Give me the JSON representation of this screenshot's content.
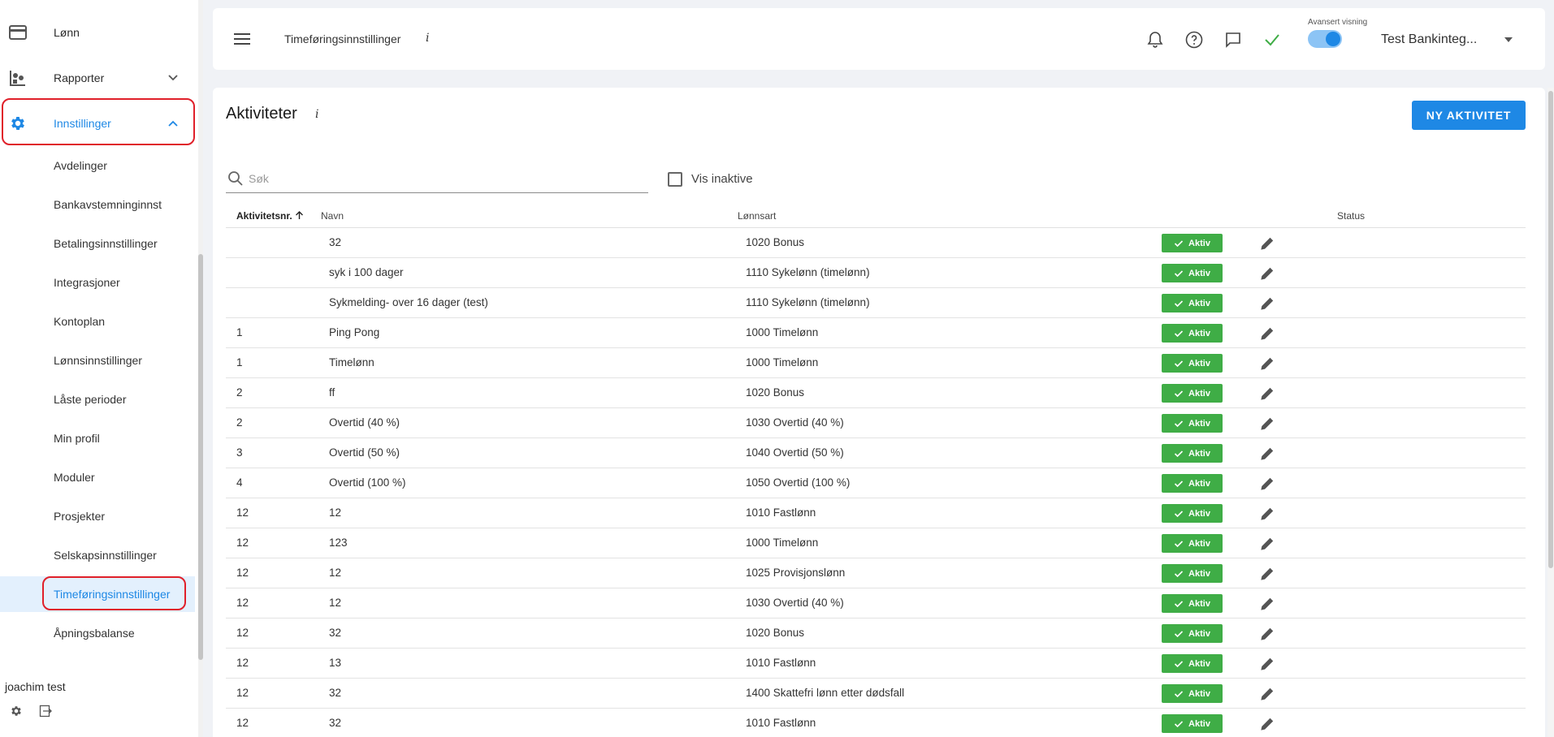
{
  "sidebar": {
    "nav": [
      {
        "label": "Lønn",
        "icon": "credit-card-icon"
      },
      {
        "label": "Rapporter",
        "icon": "reports-icon"
      },
      {
        "label": "Innstillinger",
        "icon": "gear-icon"
      }
    ],
    "sub_items": [
      {
        "label": "Avdelinger"
      },
      {
        "label": "Bankavstemninginnst"
      },
      {
        "label": "Betalingsinnstillinger"
      },
      {
        "label": "Integrasjoner"
      },
      {
        "label": "Kontoplan"
      },
      {
        "label": "Lønnsinnstillinger"
      },
      {
        "label": "Låste perioder"
      },
      {
        "label": "Min profil"
      },
      {
        "label": "Moduler"
      },
      {
        "label": "Prosjekter"
      },
      {
        "label": "Selskapsinnstillinger"
      },
      {
        "label": "Timeføringsinnstillinger"
      },
      {
        "label": "Åpningsbalanse"
      }
    ],
    "user": "joachim test",
    "accent_color": "#1e88e5",
    "highlight_color": "#e0202a"
  },
  "topbar": {
    "title": "Timeføringsinnstillinger",
    "info": "i",
    "advanced_label": "Avansert visning",
    "advanced_on": true,
    "company": "Test Bankinteg...",
    "icons": [
      "bell-icon",
      "help-icon",
      "chat-icon",
      "check-icon"
    ]
  },
  "main": {
    "title": "Aktiviteter",
    "info": "i",
    "new_button": "NY AKTIVITET",
    "search_placeholder": "Søk",
    "show_inactive_label": "Vis inaktive",
    "columns": {
      "number": "Aktivitetsnr.",
      "name": "Navn",
      "wage_type": "Lønnsart",
      "status": "Status"
    },
    "rows": [
      {
        "nr": "",
        "name": "32",
        "wage": "1020 Bonus",
        "status": "Aktiv"
      },
      {
        "nr": "",
        "name": "syk i 100 dager",
        "wage": "1110 Sykelønn (timelønn)",
        "status": "Aktiv"
      },
      {
        "nr": "",
        "name": "Sykmelding- over 16 dager (test)",
        "wage": "1110 Sykelønn (timelønn)",
        "status": "Aktiv"
      },
      {
        "nr": "1",
        "name": "Ping Pong",
        "wage": "1000 Timelønn",
        "status": "Aktiv"
      },
      {
        "nr": "1",
        "name": "Timelønn",
        "wage": "1000 Timelønn",
        "status": "Aktiv"
      },
      {
        "nr": "2",
        "name": "ff",
        "wage": "1020 Bonus",
        "status": "Aktiv"
      },
      {
        "nr": "2",
        "name": "Overtid (40 %)",
        "wage": "1030 Overtid (40 %)",
        "status": "Aktiv"
      },
      {
        "nr": "3",
        "name": "Overtid (50 %)",
        "wage": "1040 Overtid (50 %)",
        "status": "Aktiv"
      },
      {
        "nr": "4",
        "name": "Overtid (100 %)",
        "wage": "1050 Overtid (100 %)",
        "status": "Aktiv"
      },
      {
        "nr": "12",
        "name": "12",
        "wage": "1010 Fastlønn",
        "status": "Aktiv"
      },
      {
        "nr": "12",
        "name": "123",
        "wage": "1000 Timelønn",
        "status": "Aktiv"
      },
      {
        "nr": "12",
        "name": "12",
        "wage": "1025 Provisjonslønn",
        "status": "Aktiv"
      },
      {
        "nr": "12",
        "name": "12",
        "wage": "1030 Overtid (40 %)",
        "status": "Aktiv"
      },
      {
        "nr": "12",
        "name": "32",
        "wage": "1020 Bonus",
        "status": "Aktiv"
      },
      {
        "nr": "12",
        "name": "13",
        "wage": "1010 Fastlønn",
        "status": "Aktiv"
      },
      {
        "nr": "12",
        "name": "32",
        "wage": "1400 Skattefri lønn etter dødsfall",
        "status": "Aktiv"
      },
      {
        "nr": "12",
        "name": "32",
        "wage": "1010 Fastlønn",
        "status": "Aktiv"
      }
    ],
    "status_color": "#3fad46",
    "button_color": "#1e88e5"
  }
}
